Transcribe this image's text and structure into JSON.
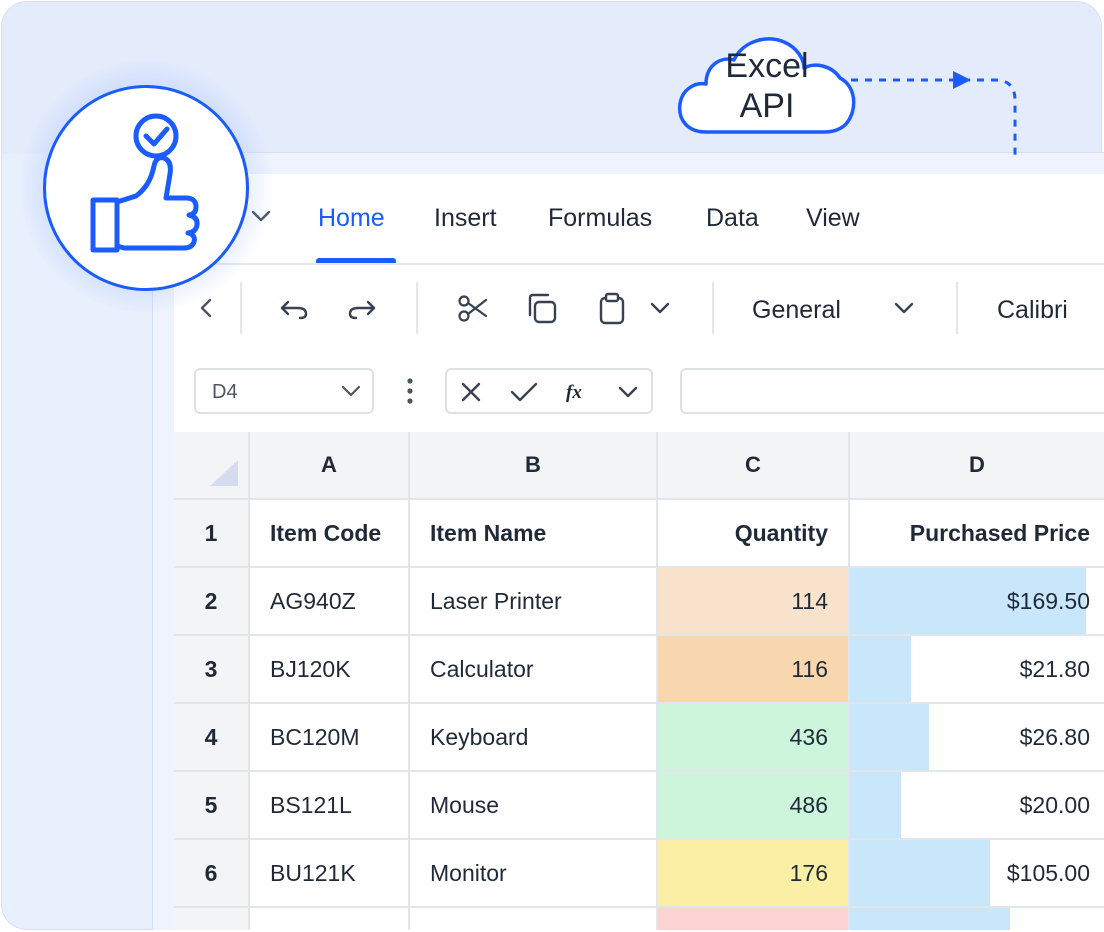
{
  "cloud": {
    "line1": "Excel",
    "line2": "API"
  },
  "ribbon": {
    "tabs": [
      "Home",
      "Insert",
      "Formulas",
      "Data",
      "View"
    ],
    "active_tab": "Home",
    "number_format": "General",
    "font_name": "Calibri"
  },
  "formula_bar": {
    "name_box": "D4",
    "formula": ""
  },
  "grid": {
    "column_headers": [
      "A",
      "B",
      "C",
      "D"
    ],
    "row_numbers": [
      "1",
      "2",
      "3",
      "4",
      "5",
      "6"
    ],
    "header_row": [
      "Item Code",
      "Item Name",
      "Quantity",
      "Purchased Price"
    ],
    "rows": [
      {
        "code": "AG940Z",
        "name": "Laser Printer",
        "quantity": "114",
        "price": "$169.50",
        "qty_color": "#f9e2cc",
        "price_fill": 0.93
      },
      {
        "code": "BJ120K",
        "name": "Calculator",
        "quantity": "116",
        "price": "$21.80",
        "qty_color": "#f9d7ae",
        "price_fill": 0.24
      },
      {
        "code": "BC120M",
        "name": "Keyboard",
        "quantity": "436",
        "price": "$26.80",
        "qty_color": "#cdf5dc",
        "price_fill": 0.31
      },
      {
        "code": "BS121L",
        "name": "Mouse",
        "quantity": "486",
        "price": "$20.00",
        "qty_color": "#cdf5dc",
        "price_fill": 0.2
      },
      {
        "code": "BU121K",
        "name": "Monitor",
        "quantity": "176",
        "price": "$105.00",
        "qty_color": "#fbefa6",
        "price_fill": 0.55
      }
    ],
    "partial_row": {
      "qty_color": "#fdd3d3",
      "price_fill": 0.63
    }
  },
  "colors": {
    "accent": "#1a5cff",
    "price_bar": "#c9e7fb"
  },
  "icons": [
    "thumbs-up-check-icon",
    "chevron-down-icon",
    "chevron-left-icon",
    "undo-icon",
    "redo-icon",
    "cut-icon",
    "copy-icon",
    "paste-icon",
    "more-vertical-icon",
    "cancel-icon",
    "confirm-icon",
    "function-icon",
    "select-all-icon"
  ]
}
